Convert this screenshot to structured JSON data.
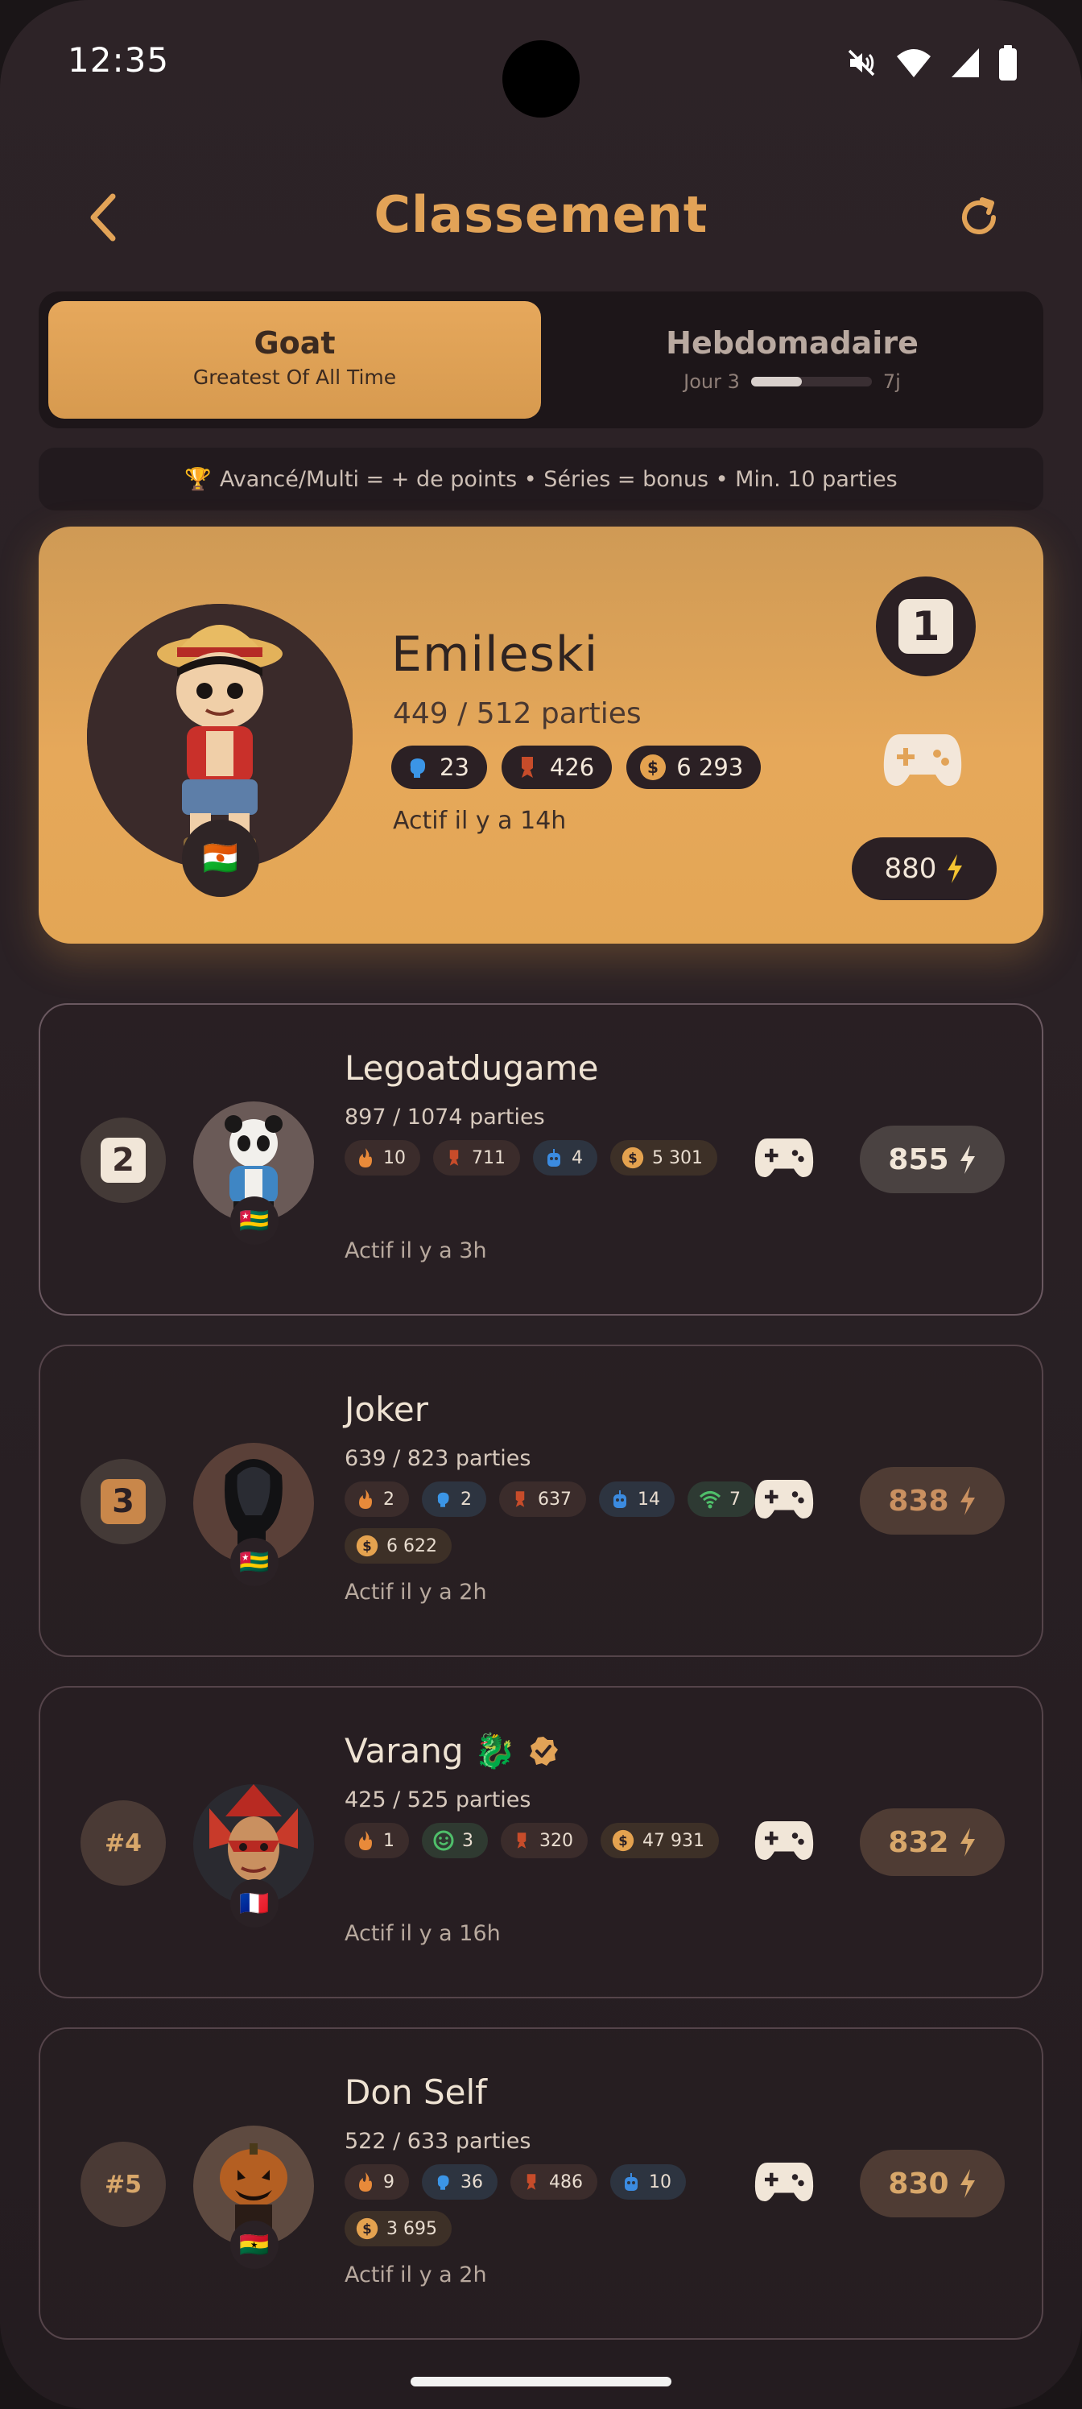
{
  "status": {
    "time": "12:35"
  },
  "header": {
    "title": "Classement"
  },
  "tabs": {
    "goat": {
      "title": "Goat",
      "subtitle": "Greatest Of All Time"
    },
    "weekly": {
      "title": "Hebdomadaire",
      "day_label": "Jour 3",
      "end_label": "7j",
      "progress": 0.42
    }
  },
  "info": {
    "icon": "trophy",
    "text": "Avancé/Multi = + de points • Séries = bonus • Min. 10 parties"
  },
  "colors": {
    "accent": "#e2a357",
    "background": "#2a2125",
    "card_border": "#55444a"
  },
  "leader": {
    "rank": "1",
    "name": "Emileski",
    "games": "449 / 512 parties",
    "stats": [
      {
        "icon": "brain",
        "value": "23"
      },
      {
        "icon": "medal",
        "value": "426"
      },
      {
        "icon": "coin",
        "value": "6 293"
      }
    ],
    "active": "Actif il y a 14h",
    "flag": "🇳🇪",
    "score": "880"
  },
  "players": [
    {
      "rank": "2",
      "name": "Legoatdugame",
      "games": "897 / 1074 parties",
      "stats": [
        {
          "icon": "fire",
          "value": "10"
        },
        {
          "icon": "medal",
          "value": "711"
        },
        {
          "icon": "robot",
          "value": "4"
        },
        {
          "icon": "coin",
          "value": "5 301"
        }
      ],
      "active": "Actif il y a 3h",
      "flag": "🇹🇬",
      "score": "855"
    },
    {
      "rank": "3",
      "name": "Joker",
      "games": "639 / 823 parties",
      "stats": [
        {
          "icon": "fire",
          "value": "2"
        },
        {
          "icon": "brain",
          "value": "2"
        },
        {
          "icon": "medal",
          "value": "637"
        },
        {
          "icon": "robot",
          "value": "14"
        },
        {
          "icon": "wifi",
          "value": "7"
        },
        {
          "icon": "coin",
          "value": "6 622"
        }
      ],
      "active": "Actif il y a 2h",
      "flag": "🇹🇬",
      "score": "838"
    },
    {
      "rank": "#4",
      "name": "Varang 🐉",
      "verified": true,
      "games": "425 / 525 parties",
      "stats": [
        {
          "icon": "fire",
          "value": "1"
        },
        {
          "icon": "smile",
          "value": "3"
        },
        {
          "icon": "medal",
          "value": "320"
        },
        {
          "icon": "coin",
          "value": "47 931"
        }
      ],
      "active": "Actif il y a 16h",
      "flag": "🇫🇷",
      "score": "832"
    },
    {
      "rank": "#5",
      "name": "Don Self",
      "games": "522 / 633 parties",
      "stats": [
        {
          "icon": "fire",
          "value": "9"
        },
        {
          "icon": "brain",
          "value": "36"
        },
        {
          "icon": "medal",
          "value": "486"
        },
        {
          "icon": "robot",
          "value": "10"
        },
        {
          "icon": "coin",
          "value": "3 695"
        }
      ],
      "active": "Actif il y a 2h",
      "flag": "🇬🇭",
      "score": "830"
    }
  ]
}
